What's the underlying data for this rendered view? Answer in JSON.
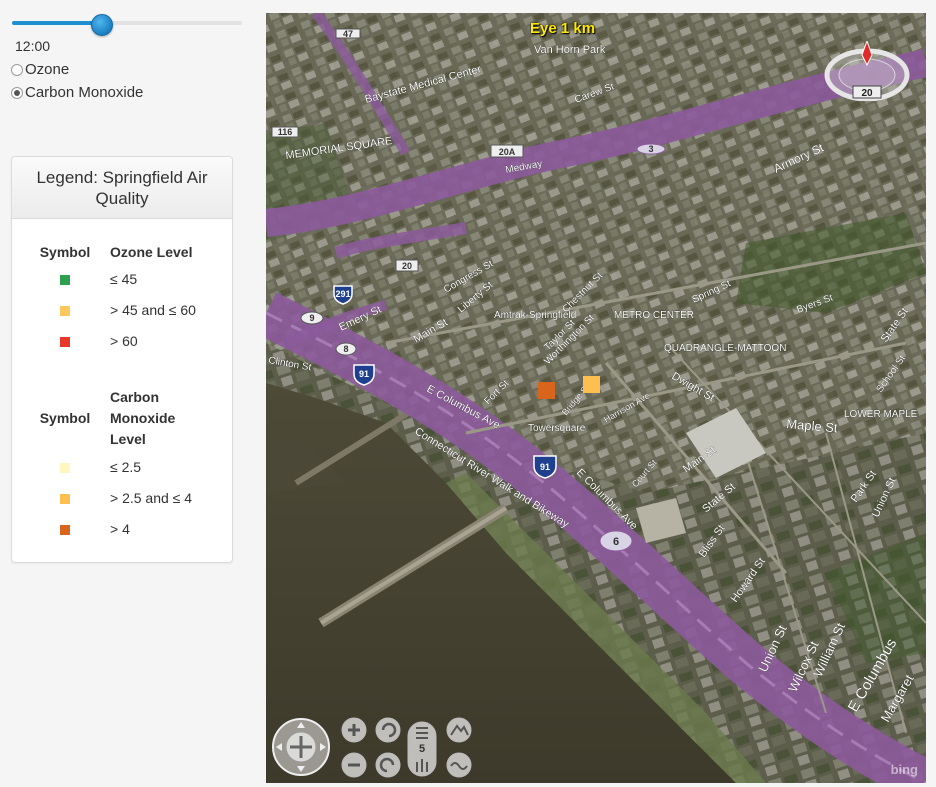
{
  "controls": {
    "time_label": "12:00",
    "time_slider_fraction": 0.39,
    "radios": [
      {
        "label": "Ozone",
        "checked": false
      },
      {
        "label": "Carbon Monoxide",
        "checked": true
      }
    ]
  },
  "legend": {
    "title": "Legend: Springfield Air Quality",
    "ozone": {
      "symbol_header": "Symbol",
      "level_header": "Ozone Level",
      "rows": [
        {
          "label": "≤ 45",
          "color": "#2e9e4f"
        },
        {
          "label": "> 45 and ≤ 60",
          "color": "#fdc75b"
        },
        {
          "label": "> 60",
          "color": "#e8362a"
        }
      ]
    },
    "co": {
      "symbol_header": "Symbol",
      "level_header": "Carbon Monoxide Level",
      "rows": [
        {
          "label": "≤ 2.5",
          "color": "#fff6c0"
        },
        {
          "label": "> 2.5 and ≤ 4",
          "color": "#fdbf4f"
        },
        {
          "label": "> 4",
          "color": "#d9641b"
        }
      ]
    }
  },
  "map": {
    "eye_altitude": "Eye  1 km",
    "compass_label": "20",
    "zoom_level": "5",
    "watermark": "bing",
    "markers": [
      {
        "color": "#d9641b",
        "level": "> 4"
      },
      {
        "color": "#fdbf4f",
        "level": "> 2.5 and ≤ 4"
      }
    ],
    "labels": {
      "van_horn_park": "Van Horn Park",
      "memorial_square": "MEMORIAL SQUARE",
      "baystate": "Baystate Medical Center",
      "amtrak": "Amtrak-Springfield",
      "metro_center": "METRO CENTER",
      "quadrangle": "QUADRANGLE-MATTOON",
      "lower_maple": "LOWER MAPLE",
      "tower_square": "Towersquare",
      "connecticut": "Connecticut River Walk and Bikeway",
      "columbus": "E Columbus Ave",
      "columbus2": "E Columbus Ave",
      "columbus3": "E Columbus",
      "main_st": "Main St",
      "main_st2": "Main St",
      "state_st": "State St",
      "state_st2": "State St",
      "dwight_st": "Dwight St",
      "maple_st": "Maple St",
      "union_st": "Union St",
      "union_st2": "Union St",
      "wilcox_st": "Wilcox St",
      "william_st": "William St",
      "howard_st": "Howard St",
      "bliss_st": "Bliss St",
      "park_st": "Park St",
      "court_st": "Court St",
      "emery_st": "Emery St",
      "clinton_st": "Clinton St",
      "byers_st": "Byers St",
      "school_st": "School St",
      "spring_st": "Spring St",
      "liberty_st": "Liberty St",
      "taylor_st": "Taylor St",
      "worthington": "Worthington St",
      "fort_st": "Fort St",
      "carew_st": "Carew St",
      "armory_st": "Armory St",
      "medway": "Medway",
      "chestnut_st": "Chestnut St",
      "congress_st": "Congress St",
      "harrison_ave": "Harrison Ave",
      "bridge_st": "Bridge St",
      "margaret": "Margaret"
    },
    "shields": {
      "i291": "291",
      "i91_a": "91",
      "i91_b": "91",
      "exit_6": "6",
      "exit_8": "8",
      "exit_9": "9",
      "exit_20": "20",
      "exit_20a": "20A",
      "exit_3": "3",
      "exit_116": "116",
      "exit_47": "47"
    }
  }
}
